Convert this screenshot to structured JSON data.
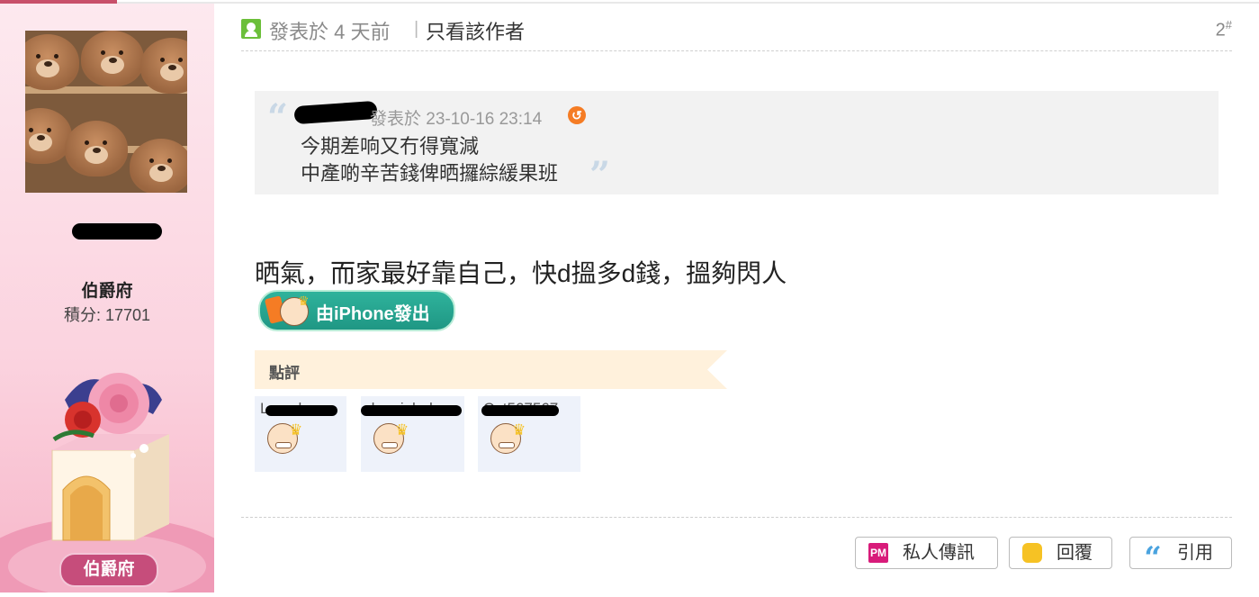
{
  "post": {
    "posted_ago": "發表於 4 天前",
    "separator": "|",
    "only_author": "只看該作者",
    "floor": "2",
    "floor_sup": "#"
  },
  "sidebar": {
    "rank_title": "伯爵府",
    "points": "積分: 17701",
    "medal_label": "伯爵府"
  },
  "quote": {
    "posted": "發表於 23-10-16 23:14",
    "lines": [
      "今期差响又冇得寬減",
      "中產啲辛苦錢俾晒攞綜緩果班"
    ]
  },
  "body": {
    "text": "晒氣，而家最好靠自己，快d搵多d錢，搵夠閃人",
    "device_badge": "由iPhone發出"
  },
  "ratings": {
    "title": "點評",
    "raters": [
      {
        "name": "Lamabeee"
      },
      {
        "name": "danniehaha"
      },
      {
        "name": "Cat567567"
      }
    ]
  },
  "actions": {
    "pm": "私人傳訊",
    "pm_icon": "PM",
    "reply": "回覆",
    "quote": "引用",
    "quote_icon": "“"
  },
  "colors": {
    "accent": "#c8506a",
    "medal": "#c64d7b",
    "badge": "#1f9784"
  }
}
